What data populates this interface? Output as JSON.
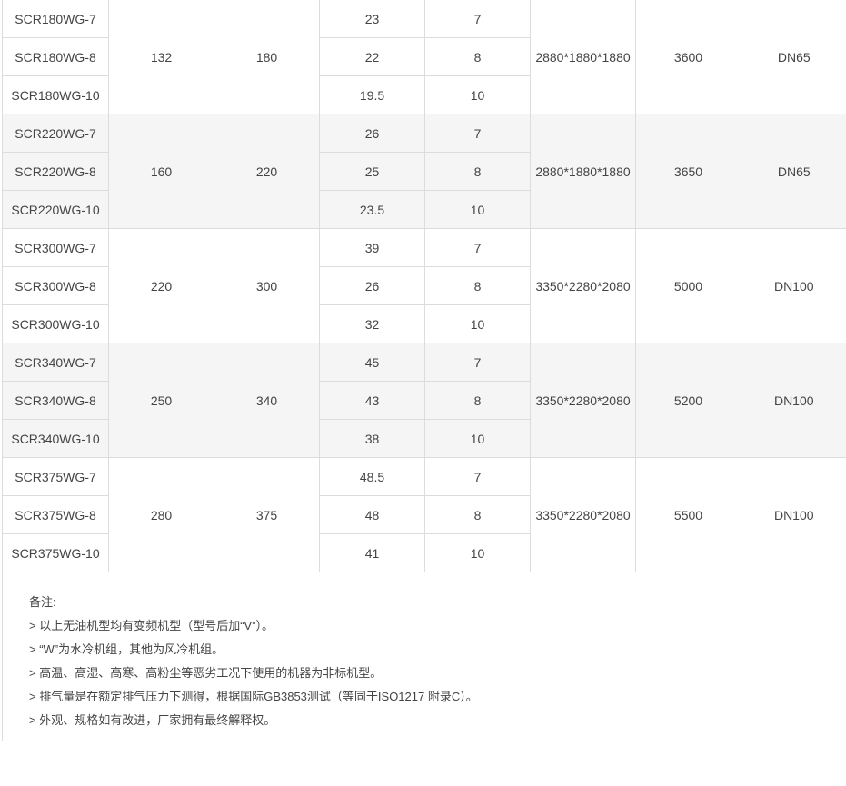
{
  "table": {
    "groups": [
      {
        "models": [
          "SCR180WG-7",
          "SCR180WG-8",
          "SCR180WG-10"
        ],
        "power_kw": "132",
        "power_hp": "180",
        "air_volume": [
          "23",
          "22",
          "19.5"
        ],
        "pressure": [
          "7",
          "8",
          "10"
        ],
        "dimensions": "2880*1880*1880",
        "weight": "3600",
        "outlet": "DN65"
      },
      {
        "models": [
          "SCR220WG-7",
          "SCR220WG-8",
          "SCR220WG-10"
        ],
        "power_kw": "160",
        "power_hp": "220",
        "air_volume": [
          "26",
          "25",
          "23.5"
        ],
        "pressure": [
          "7",
          "8",
          "10"
        ],
        "dimensions": "2880*1880*1880",
        "weight": "3650",
        "outlet": "DN65"
      },
      {
        "models": [
          "SCR300WG-7",
          "SCR300WG-8",
          "SCR300WG-10"
        ],
        "power_kw": "220",
        "power_hp": "300",
        "air_volume": [
          "39",
          "26",
          "32"
        ],
        "pressure": [
          "7",
          "8",
          "10"
        ],
        "dimensions": "3350*2280*2080",
        "weight": "5000",
        "outlet": "DN100"
      },
      {
        "models": [
          "SCR340WG-7",
          "SCR340WG-8",
          "SCR340WG-10"
        ],
        "power_kw": "250",
        "power_hp": "340",
        "air_volume": [
          "45",
          "43",
          "38"
        ],
        "pressure": [
          "7",
          "8",
          "10"
        ],
        "dimensions": "3350*2280*2080",
        "weight": "5200",
        "outlet": "DN100"
      },
      {
        "models": [
          "SCR375WG-7",
          "SCR375WG-8",
          "SCR375WG-10"
        ],
        "power_kw": "280",
        "power_hp": "375",
        "air_volume": [
          "48.5",
          "48",
          "41"
        ],
        "pressure": [
          "7",
          "8",
          "10"
        ],
        "dimensions": "3350*2280*2080",
        "weight": "5500",
        "outlet": "DN100"
      }
    ]
  },
  "notes": {
    "title": "备注:",
    "lines": [
      "> 以上无油机型均有变频机型（型号后加“V”）。",
      " > “W”为水冷机组，其他为风冷机组。",
      "> 高温、高湿、高寒、高粉尘等恶劣工况下使用的机器为非标机型。",
      "> 排气量是在额定排气压力下测得，根据国际GB3853测试（等同于ISO1217 附录C）。",
      " > 外观、规格如有改进，厂家拥有最终解释权。"
    ]
  }
}
